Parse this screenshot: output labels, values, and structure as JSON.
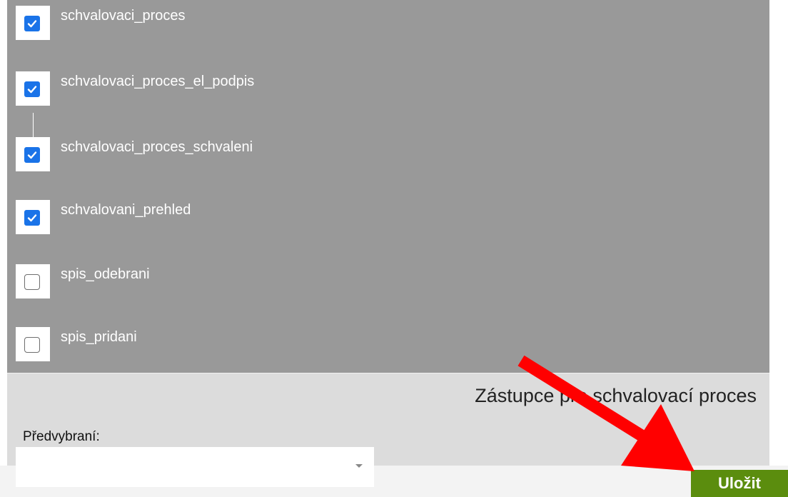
{
  "permissions": [
    {
      "label": "schvalovaci_proces",
      "checked": true
    },
    {
      "label": "schvalovaci_proces_el_podpis",
      "checked": true
    },
    {
      "label": "schvalovaci_proces_schvaleni",
      "checked": true
    },
    {
      "label": "schvalovani_prehled",
      "checked": true
    },
    {
      "label": "spis_odebrani",
      "checked": false
    },
    {
      "label": "spis_pridani",
      "checked": false
    }
  ],
  "substitute_section": {
    "title": "Zástupce pro schvalovací proces",
    "preselected_label": "Předvybraní:",
    "preselected_value": ""
  },
  "save_button": {
    "label": "Uložit"
  },
  "colors": {
    "panel_gray": "#999999",
    "checkbox_blue": "#1a73e8",
    "save_green": "#5b8d0e",
    "arrow_red": "#ff0000"
  },
  "icons": {
    "checked": "check-icon",
    "dropdown": "caret-down-icon",
    "annotation": "red-arrow"
  }
}
